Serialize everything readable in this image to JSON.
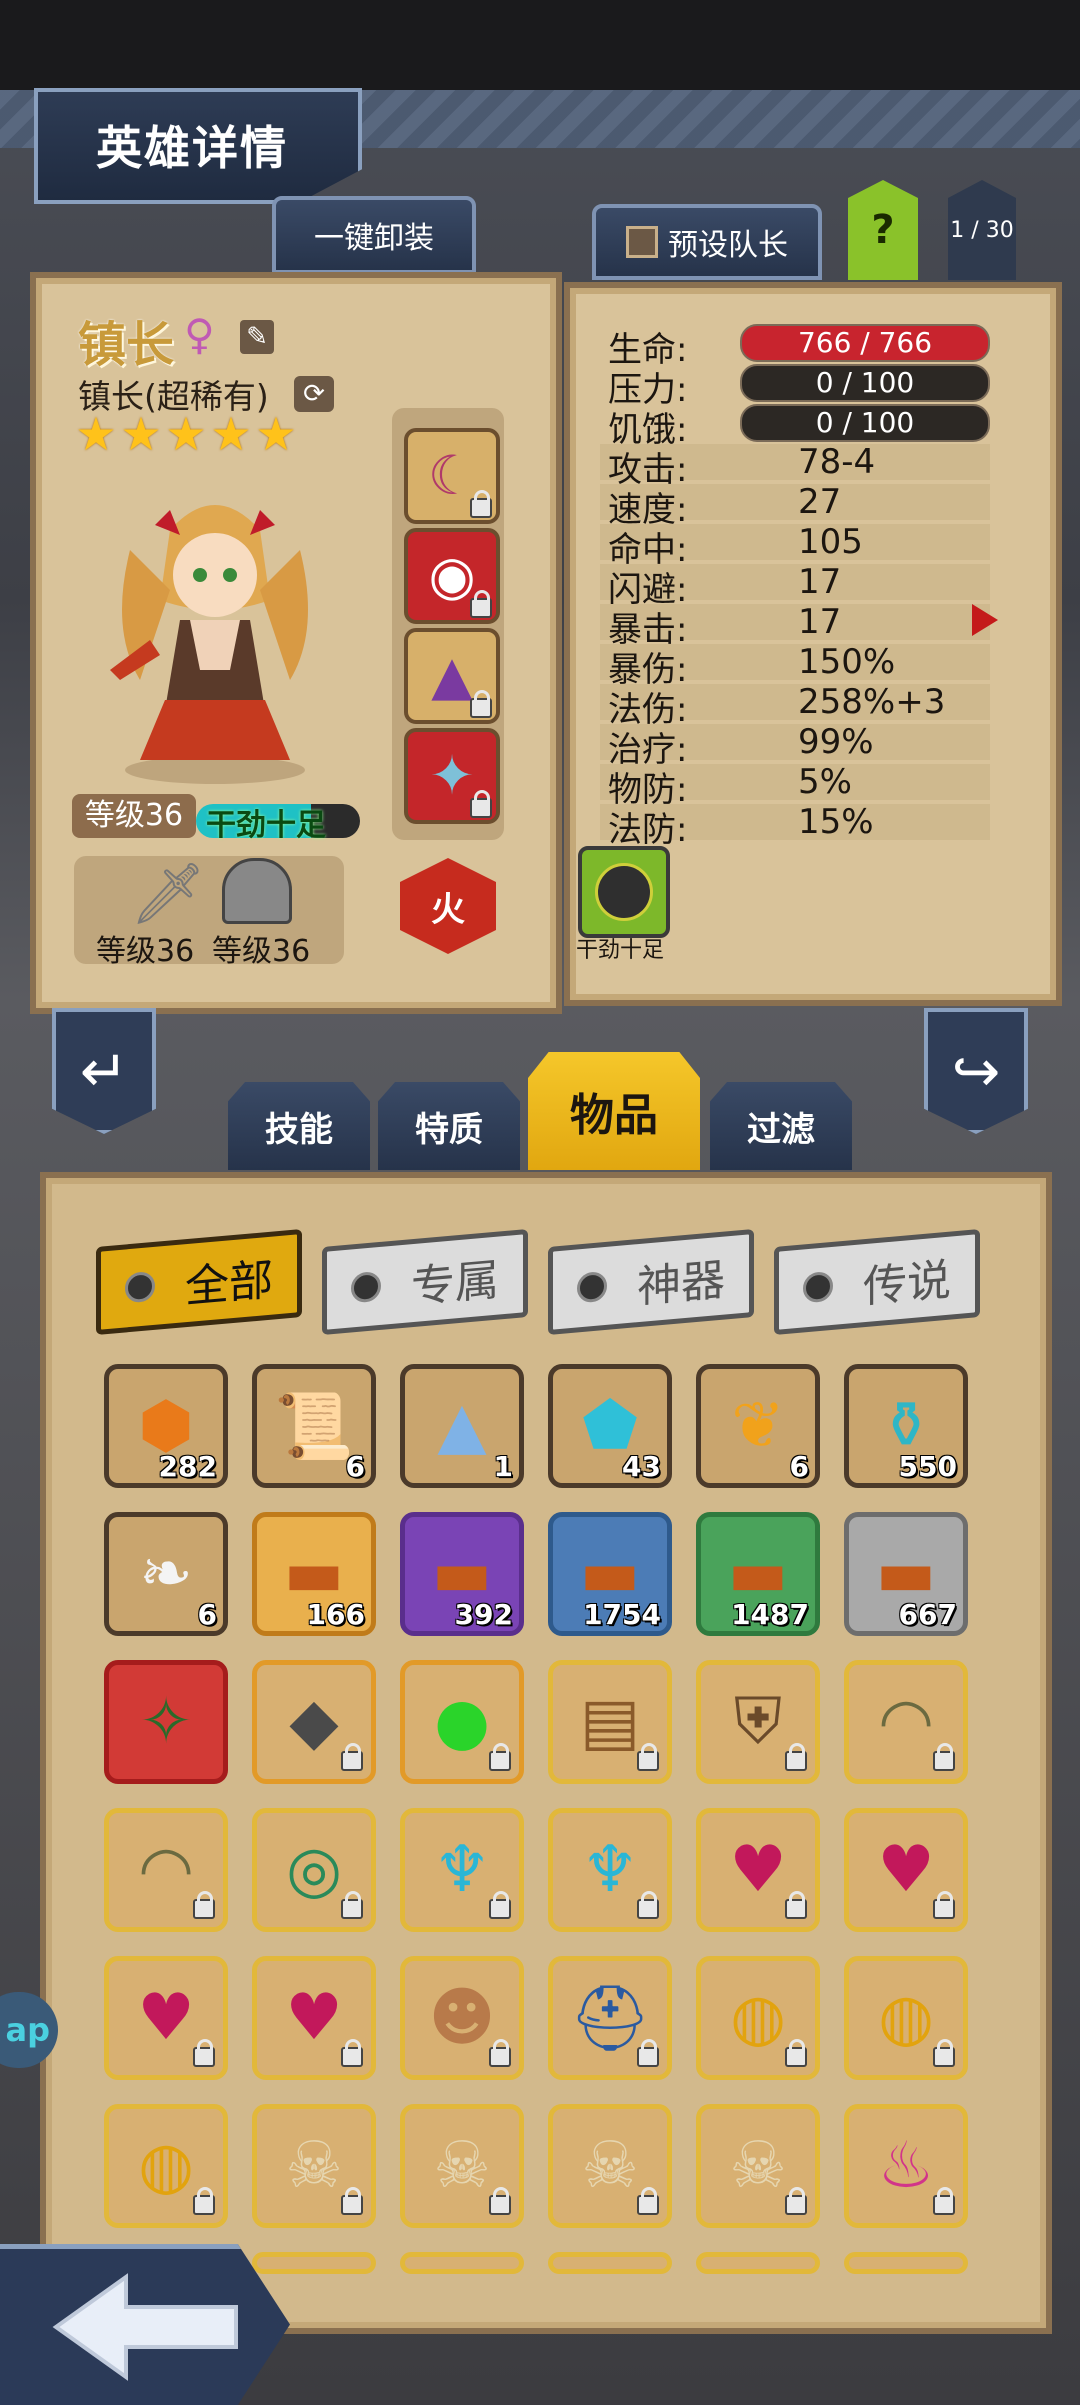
{
  "header": {
    "title": "英雄详情"
  },
  "top_buttons": {
    "unequip_all": "一键卸装",
    "preset_captain": "预设队长",
    "help": "?",
    "page_indicator": "1 / 30"
  },
  "hero": {
    "name": "镇长",
    "gender_symbol": "♀",
    "class_title": "镇长(超稀有)",
    "stars": 5,
    "level_label": "等级36",
    "trait_badge": "干劲十足",
    "weapon_level": "等级36",
    "armor_level": "等级36",
    "element": "火",
    "status_icon_label": "干劲十足"
  },
  "stats": [
    {
      "label": "生命:",
      "value": "766 / 766",
      "bar": true,
      "bar_color": "#c8242e"
    },
    {
      "label": "压力:",
      "value": "0 / 100",
      "bar": true,
      "bar_color": "#2c2824"
    },
    {
      "label": "饥饿:",
      "value": "0 / 100",
      "bar": true,
      "bar_color": "#2c2824"
    },
    {
      "label": "攻击:",
      "value": "78-4"
    },
    {
      "label": "速度:",
      "value": "27"
    },
    {
      "label": "命中:",
      "value": "105"
    },
    {
      "label": "闪避:",
      "value": "17"
    },
    {
      "label": "暴击:",
      "value": "17"
    },
    {
      "label": "暴伤:",
      "value": "150%"
    },
    {
      "label": "法伤:",
      "value": "258%+3"
    },
    {
      "label": "治疗:",
      "value": "99%"
    },
    {
      "label": "物防:",
      "value": "5%"
    },
    {
      "label": "法防:",
      "value": "15%"
    }
  ],
  "category_tabs": [
    {
      "label": "技能",
      "active": false
    },
    {
      "label": "特质",
      "active": false
    },
    {
      "label": "物品",
      "active": true
    },
    {
      "label": "过滤",
      "active": false
    }
  ],
  "filters": [
    {
      "label": "全部",
      "active": true
    },
    {
      "label": "专属",
      "active": false
    },
    {
      "label": "神器",
      "active": false
    },
    {
      "label": "传说",
      "active": false
    }
  ],
  "inventory": [
    [
      {
        "icon": "orange-gem-icon",
        "count": "282",
        "frame": "#4b3a2a",
        "bg": "#c9a56e",
        "locked": false
      },
      {
        "icon": "scroll-icon",
        "count": "6",
        "frame": "#4b3a2a",
        "bg": "#c9a56e",
        "locked": false
      },
      {
        "icon": "blue-powder-icon",
        "count": "1",
        "frame": "#4b3a2a",
        "bg": "#c9a56e",
        "locked": false
      },
      {
        "icon": "rune-stone-icon",
        "count": "43",
        "frame": "#4b3a2a",
        "bg": "#c9a56e",
        "locked": false
      },
      {
        "icon": "golden-feather-icon",
        "count": "6",
        "frame": "#4b3a2a",
        "bg": "#c9a56e",
        "locked": false
      },
      {
        "icon": "potion-icon",
        "count": "550",
        "frame": "#4b3a2a",
        "bg": "#c9a56e",
        "locked": false
      }
    ],
    [
      {
        "icon": "white-feather-icon",
        "count": "6",
        "frame": "#4b3a2a",
        "bg": "#c9a56e",
        "locked": false
      },
      {
        "icon": "chest-icon",
        "count": "166",
        "frame": "#c07b1a",
        "bg": "#e9b04d",
        "locked": false
      },
      {
        "icon": "chest-icon",
        "count": "392",
        "frame": "#5a2e8c",
        "bg": "#7a44b5",
        "locked": false
      },
      {
        "icon": "chest-icon",
        "count": "1754",
        "frame": "#2e5a8c",
        "bg": "#4c7cb6",
        "locked": false
      },
      {
        "icon": "chest-icon",
        "count": "1487",
        "frame": "#2f7a3e",
        "bg": "#4aa35b",
        "locked": false
      },
      {
        "icon": "chest-icon",
        "count": "667",
        "frame": "#6d6d6d",
        "bg": "#a9a9a9",
        "locked": false
      }
    ],
    [
      {
        "icon": "wand-icon",
        "count": "",
        "frame": "#a51c1c",
        "bg": "#d23a36",
        "locked": false
      },
      {
        "icon": "spiked-armor-icon",
        "count": "",
        "frame": "#e29a28",
        "bg": "#d8b072",
        "locked": true
      },
      {
        "icon": "green-potion-icon",
        "count": "",
        "frame": "#e29a28",
        "bg": "#d8b072",
        "locked": true
      },
      {
        "icon": "satchel-icon",
        "count": "",
        "frame": "#e2b83a",
        "bg": "#d8b072",
        "locked": true
      },
      {
        "icon": "shield-icon",
        "count": "",
        "frame": "#e2b83a",
        "bg": "#d8b072",
        "locked": true
      },
      {
        "icon": "hood-icon",
        "count": "",
        "frame": "#e2b83a",
        "bg": "#d8b072",
        "locked": true
      }
    ],
    [
      {
        "icon": "hood-icon",
        "count": "",
        "frame": "#e2b83a",
        "bg": "#d8b072",
        "locked": true
      },
      {
        "icon": "ring-icon",
        "count": "",
        "frame": "#e2b83a",
        "bg": "#d8b072",
        "locked": true
      },
      {
        "icon": "crystal-helm-icon",
        "count": "",
        "frame": "#e2b83a",
        "bg": "#d8b072",
        "locked": true
      },
      {
        "icon": "crystal-helm-icon",
        "count": "",
        "frame": "#e2b83a",
        "bg": "#d8b072",
        "locked": true
      },
      {
        "icon": "heart-axe-icon",
        "count": "",
        "frame": "#e2b83a",
        "bg": "#d8b072",
        "locked": true
      },
      {
        "icon": "heart-axe-icon",
        "count": "",
        "frame": "#e2b83a",
        "bg": "#d8b072",
        "locked": true
      }
    ],
    [
      {
        "icon": "heart-axe-icon",
        "count": "",
        "frame": "#e2b83a",
        "bg": "#d8b072",
        "locked": true
      },
      {
        "icon": "heart-axe-icon",
        "count": "",
        "frame": "#e2b83a",
        "bg": "#d8b072",
        "locked": true
      },
      {
        "icon": "voodoo-doll-icon",
        "count": "",
        "frame": "#e2b83a",
        "bg": "#d8b072",
        "locked": true
      },
      {
        "icon": "knight-helm-icon",
        "count": "",
        "frame": "#e2b83a",
        "bg": "#d8b072",
        "locked": true
      },
      {
        "icon": "dragon-ring-icon",
        "count": "",
        "frame": "#e2b83a",
        "bg": "#d8b072",
        "locked": true
      },
      {
        "icon": "dragon-ring-icon",
        "count": "",
        "frame": "#e2b83a",
        "bg": "#d8b072",
        "locked": true
      }
    ],
    [
      {
        "icon": "dragon-ring-icon",
        "count": "",
        "frame": "#e2b83a",
        "bg": "#d8b072",
        "locked": true
      },
      {
        "icon": "skull-staff-icon",
        "count": "",
        "frame": "#e2b83a",
        "bg": "#d8b072",
        "locked": true
      },
      {
        "icon": "skull-staff-icon",
        "count": "",
        "frame": "#e2b83a",
        "bg": "#d8b072",
        "locked": true
      },
      {
        "icon": "skull-staff-icon",
        "count": "",
        "frame": "#e2b83a",
        "bg": "#d8b072",
        "locked": true
      },
      {
        "icon": "skull-staff-icon",
        "count": "",
        "frame": "#e2b83a",
        "bg": "#d8b072",
        "locked": true
      },
      {
        "icon": "pouch-icon",
        "count": "",
        "frame": "#e2b83a",
        "bg": "#d8b072",
        "locked": true
      }
    ]
  ],
  "side_peek_text": "ap"
}
